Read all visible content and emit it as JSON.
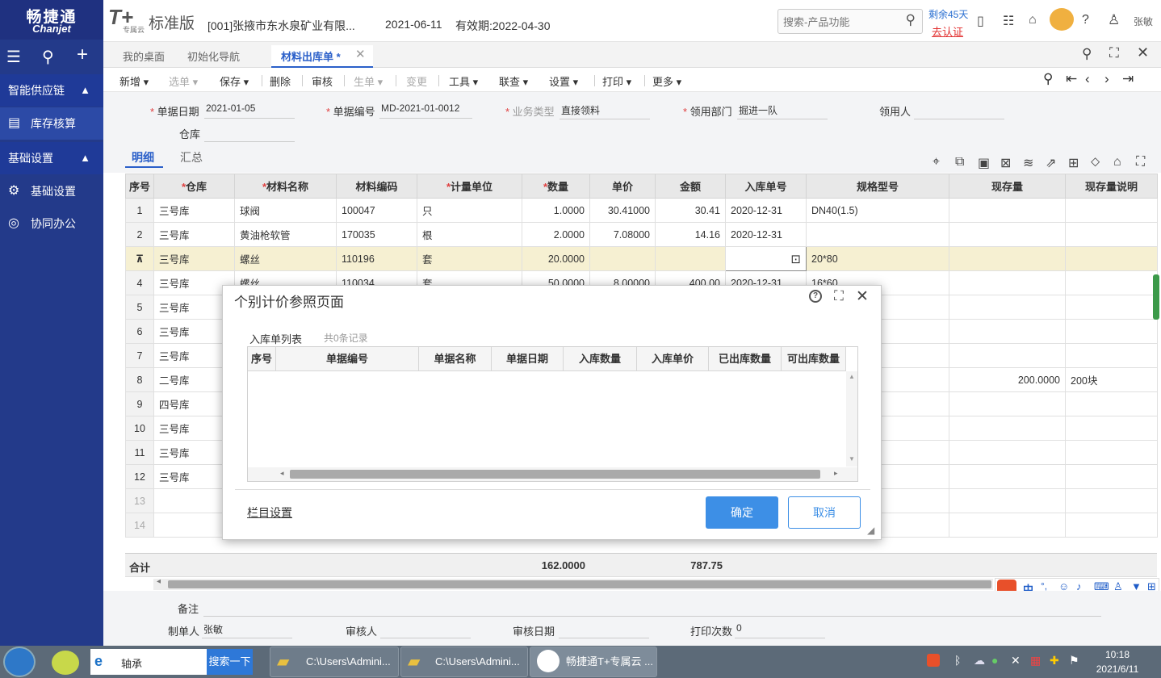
{
  "logo": {
    "cn": "畅捷通",
    "en": "Chanjet"
  },
  "sidebar": {
    "group1": "智能供应链",
    "item1": "库存核算",
    "group2": "基础设置",
    "item2": "基础设置",
    "item3": "协同办公"
  },
  "header": {
    "brand": "T+",
    "brand_sub": "专属云",
    "edition": "标准版",
    "company": "[001]张掖市东水泉矿业有限...",
    "date": "2021-06-11",
    "validity": "有效期:2022-04-30",
    "search_placeholder": "搜索-产品功能",
    "remaining": "剩余45天",
    "certify": "去认证",
    "user": "张敏"
  },
  "tabs": [
    {
      "label": "我的桌面"
    },
    {
      "label": "初始化导航"
    },
    {
      "label": "材料出库单 *"
    }
  ],
  "toolbar": {
    "new": "新增",
    "select": "选单",
    "save": "保存",
    "delete": "删除",
    "audit": "审核",
    "generate": "生单",
    "change": "变更",
    "tools": "工具",
    "query": "联查",
    "settings": "设置",
    "print": "打印",
    "more": "更多"
  },
  "form": {
    "date_label": "单据日期",
    "date": "2021-01-05",
    "code_label": "单据编号",
    "code": "MD-2021-01-0012",
    "biz_label": "业务类型",
    "biz": "直接领料",
    "dept_label": "领用部门",
    "dept": "掘进一队",
    "person_label": "领用人",
    "warehouse_label": "仓库"
  },
  "subtabs": {
    "detail": "明细",
    "summary": "汇总"
  },
  "grid": {
    "headers": [
      "序号",
      "仓库",
      "材料名称",
      "材料编码",
      "计量单位",
      "数量",
      "单价",
      "金额",
      "入库单号",
      "规格型号",
      "现存量",
      "现存量说明"
    ],
    "rows": [
      [
        "1",
        "三号库",
        "球阀",
        "100047",
        "只",
        "1.0000",
        "30.41000",
        "30.41",
        "2020-12-31",
        "DN40(1.5)",
        "",
        ""
      ],
      [
        "2",
        "三号库",
        "黄油枪软管",
        "170035",
        "根",
        "2.0000",
        "7.08000",
        "14.16",
        "2020-12-31",
        "",
        "",
        ""
      ],
      [
        "",
        "三号库",
        "螺丝",
        "110196",
        "套",
        "20.0000",
        "",
        "",
        "",
        "20*80",
        "",
        ""
      ],
      [
        "4",
        "三号库",
        "螺丝",
        "110034",
        "套",
        "50.0000",
        "8.00000",
        "400.00",
        "2020-12-31",
        "16*60",
        "",
        ""
      ],
      [
        "5",
        "三号库",
        "",
        "",
        "",
        "",
        "",
        "",
        "",
        "",
        "",
        ""
      ],
      [
        "6",
        "三号库",
        "",
        "",
        "",
        "",
        "",
        "",
        "",
        "",
        "",
        ""
      ],
      [
        "7",
        "三号库",
        "",
        "",
        "",
        "",
        "",
        "",
        "",
        "",
        "",
        ""
      ],
      [
        "8",
        "二号库",
        "",
        "",
        "",
        "",
        "",
        "",
        "",
        "",
        "200.0000",
        "200块"
      ],
      [
        "9",
        "四号库",
        "",
        "",
        "",
        "",
        "",
        "",
        "",
        "",
        "",
        ""
      ],
      [
        "10",
        "三号库",
        "",
        "",
        "",
        "",
        "",
        "",
        "",
        "",
        "",
        ""
      ],
      [
        "11",
        "三号库",
        "",
        "",
        "",
        "",
        "",
        "",
        "",
        "",
        "",
        ""
      ],
      [
        "12",
        "三号库",
        "",
        "",
        "",
        "",
        "",
        "",
        "",
        "",
        "",
        ""
      ],
      [
        "13",
        "",
        "",
        "",
        "",
        "",
        "",
        "",
        "",
        "",
        "",
        ""
      ],
      [
        "14",
        "",
        "",
        "",
        "",
        "",
        "",
        "",
        "",
        "",
        "",
        ""
      ]
    ],
    "total_label": "合计",
    "total_qty": "162.0000",
    "total_amount": "787.75"
  },
  "footer": {
    "remark_label": "备注",
    "creator_label": "制单人",
    "creator": "张敏",
    "auditor_label": "审核人",
    "audit_date_label": "审核日期",
    "print_count_label": "打印次数",
    "print_count": "0"
  },
  "dialog": {
    "title": "个别计价参照页面",
    "list_label": "入库单列表",
    "count": "共0条记录",
    "headers": [
      "序号",
      "单据编号",
      "单据名称",
      "单据日期",
      "入库数量",
      "入库单价",
      "已出库数量",
      "可出库数量"
    ],
    "column_settings": "栏目设置",
    "ok": "确定",
    "cancel": "取消"
  },
  "taskbar": {
    "search_value": "轴承",
    "search_button": "搜索一下",
    "task1": "C:\\Users\\Admini...",
    "task2": "C:\\Users\\Admini...",
    "task3": "畅捷通T+专属云 ...",
    "time": "10:18",
    "date": "2021/6/11"
  },
  "ime": {
    "lang": "中"
  }
}
